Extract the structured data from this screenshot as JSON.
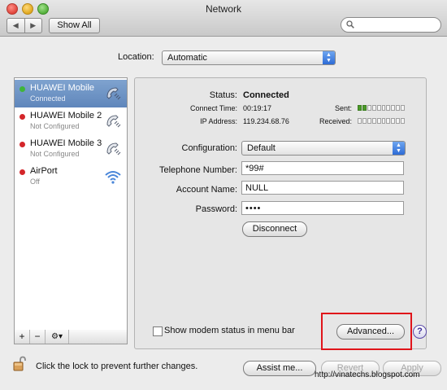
{
  "window": {
    "title": "Network"
  },
  "toolbar": {
    "back": "◀",
    "forward": "▶",
    "show_all": "Show All",
    "search_placeholder": ""
  },
  "location": {
    "label": "Location:",
    "value": "Automatic"
  },
  "services": [
    {
      "name": "HUAWEI Mobile",
      "status": "Connected",
      "dot_color": "#3fb53a",
      "icon": "phone-modem-icon",
      "selected": true
    },
    {
      "name": "HUAWEI Mobile 2",
      "status": "Not Configured",
      "dot_color": "#d4262a",
      "icon": "phone-modem-icon",
      "selected": false
    },
    {
      "name": "HUAWEI Mobile 3",
      "status": "Not Configured",
      "dot_color": "#d4262a",
      "icon": "phone-modem-icon",
      "selected": false
    },
    {
      "name": "AirPort",
      "status": "Off",
      "dot_color": "#d4262a",
      "icon": "wifi-icon",
      "selected": false
    }
  ],
  "sidebar_toolbar": {
    "add": "+",
    "remove": "−",
    "action": "⚙▾"
  },
  "status": {
    "status_label": "Status:",
    "status_value": "Connected",
    "connect_time_label": "Connect Time:",
    "connect_time_value": "00:19:17",
    "ip_label": "IP Address:",
    "ip_value": "119.234.68.76",
    "sent_label": "Sent:",
    "received_label": "Received:",
    "sent_level": 0.2,
    "received_level": 0.0
  },
  "form": {
    "configuration_label": "Configuration:",
    "configuration_value": "Default",
    "telephone_label": "Telephone Number:",
    "telephone_value": "*99#",
    "account_label": "Account Name:",
    "account_value": "NULL",
    "password_label": "Password:",
    "password_value": "••••"
  },
  "buttons": {
    "disconnect": "Disconnect",
    "advanced": "Advanced...",
    "help": "?",
    "assist": "Assist me...",
    "revert": "Revert",
    "apply": "Apply"
  },
  "modem_status_label": "Show modem status in menu bar",
  "modem_status_checked": false,
  "lock_text": "Click the lock to prevent further changes.",
  "watermark": "http://vinatechs.blogspot.com",
  "colors": {
    "highlight_box": "#e0141a",
    "selection": "#6f94c6"
  }
}
